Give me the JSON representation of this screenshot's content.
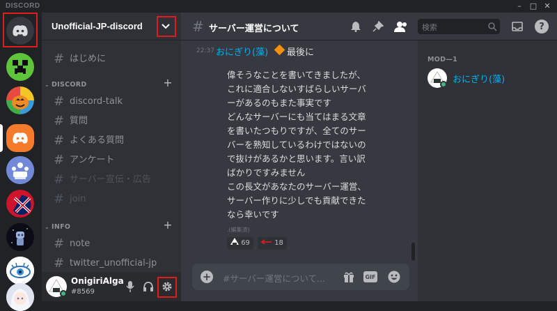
{
  "window": {
    "brand": "DISCORD",
    "minimize": "–",
    "maximize": "□",
    "close": "✕"
  },
  "guilds": [
    {
      "name": "home",
      "icon": "discord-logo-icon"
    },
    {
      "name": "creeper-server",
      "icon": "creeper-icon"
    },
    {
      "name": "pumpkin-server",
      "icon": "pumpkin-icon"
    },
    {
      "name": "unofficial-jp-discord",
      "icon": "discord-logo-icon"
    },
    {
      "name": "meeting-server",
      "icon": "meeting-icon"
    },
    {
      "name": "uk-server",
      "icon": "uk-flag-icon"
    },
    {
      "name": "robot-server",
      "icon": "robot-icon"
    },
    {
      "name": "eye-server",
      "icon": "eye-icon"
    },
    {
      "name": "anime-server",
      "icon": "anime-avatar-icon"
    }
  ],
  "server": {
    "name": "Unofficial-JP-discord",
    "top_channels": [
      "はじめに"
    ],
    "categories": [
      {
        "name": "DISCORD",
        "channels": [
          "discord-talk",
          "質問",
          "よくある質問",
          "アンケート",
          "サーバー宣伝・広告",
          "join"
        ]
      },
      {
        "name": "INFO",
        "channels": [
          "note",
          "twitter_unofficial-jp"
        ]
      }
    ]
  },
  "user": {
    "name": "OnigiriAlga",
    "tag": "#8569"
  },
  "channel": {
    "name": "サーバー運営について",
    "search_placeholder": "検索"
  },
  "message": {
    "time": "22:37",
    "author": "おにぎり(藻)",
    "header_text": "最後に",
    "lines": [
      "偉そうなことを書いてきましたが、",
      "これに適合しないすばらしいサーバ",
      "ーがあるのもまた事実です",
      "どんなサーバーにも当てはまる文章",
      "を書いたつもりですが、全てのサー",
      "バーを熟知しているわけではないの",
      "で抜けがあるかと思います。言い訳",
      "ばかりですみません",
      "この長文があなたのサーバー運営、",
      "サーバー作りに少しでも貢献できた",
      "なら幸いです"
    ],
    "edited": ".(編集済)",
    "reactions": [
      {
        "emoji": "onigiri-icon",
        "count": "69"
      },
      {
        "emoji": "arrow-left-icon",
        "count": "18"
      }
    ]
  },
  "composer": {
    "placeholder": "#サーバー運営について..."
  },
  "members": {
    "role": "MOD—1",
    "list": [
      {
        "name": "おにぎり(藻)",
        "status": "online"
      }
    ]
  },
  "colors": {
    "accent": "#7289da",
    "highlight": "#e01c1c",
    "link": "#00b0f4",
    "online": "#43b581"
  }
}
